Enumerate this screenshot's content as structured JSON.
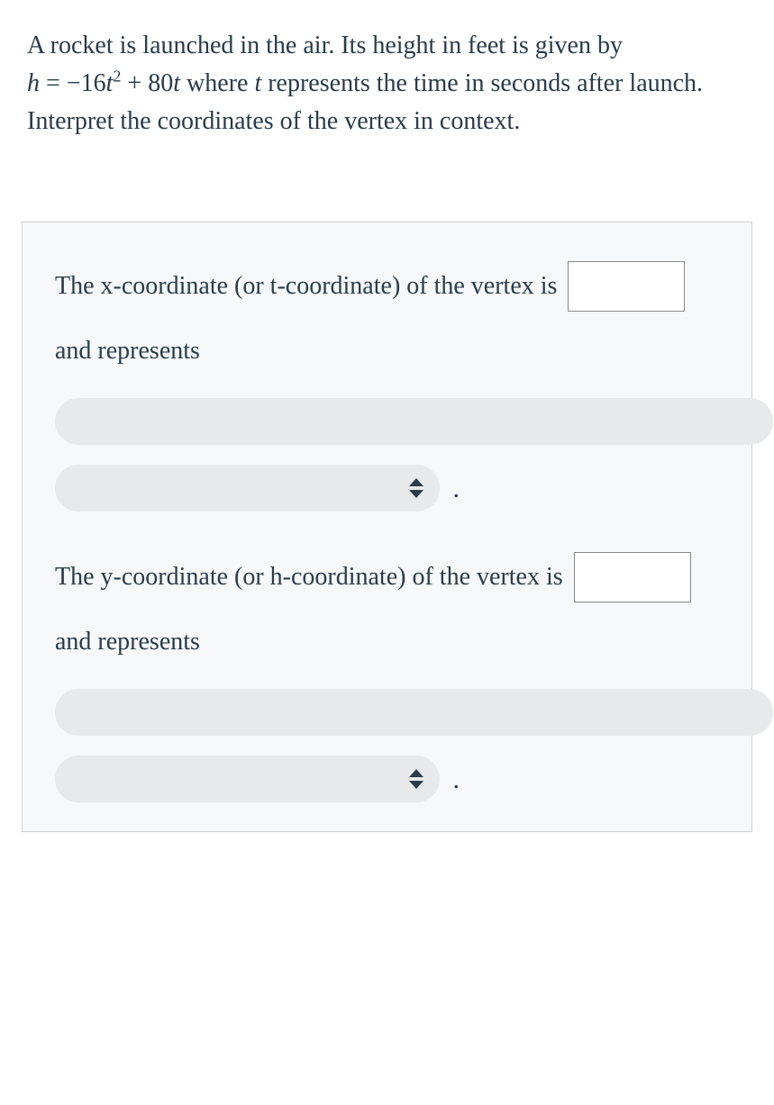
{
  "question": {
    "pre": "A rocket is launched in the air. Its height in feet is given by ",
    "eq_lhs_var": "h",
    "eq_rhs": " = −16",
    "eq_var2": "t",
    "eq_sup": "2",
    "eq_plus": " + 80",
    "eq_var3": "t",
    "post1": " where ",
    "post_var": "t",
    "post2": " represents the time in seconds after launch. Interpret the coordinates of the vertex in context."
  },
  "answer": {
    "line1a": "The x-coordinate (or t-coordinate) of the vertex is",
    "line1b": "and represents",
    "period1": ".",
    "line2a": "The y-coordinate (or h-coordinate) of the vertex is",
    "line2b": "and represents",
    "period2": "."
  },
  "inputs": {
    "x_value": "",
    "y_value": ""
  },
  "dropdowns": {
    "x_desc_wide": "",
    "x_desc_half": "",
    "y_desc_wide": "",
    "y_desc_half": ""
  }
}
